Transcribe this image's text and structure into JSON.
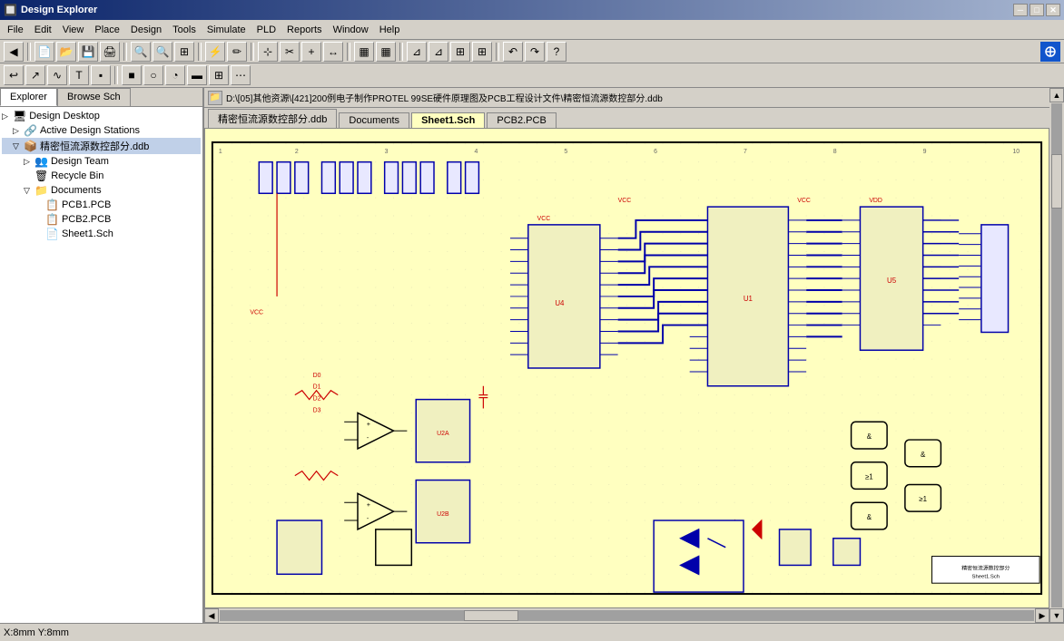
{
  "titlebar": {
    "title": "Design Explorer",
    "minimize": "─",
    "maximize": "□",
    "close": "✕"
  },
  "menu": {
    "items": [
      "File",
      "Edit",
      "View",
      "Place",
      "Design",
      "Tools",
      "Simulate",
      "PLD",
      "Reports",
      "Window",
      "Help"
    ]
  },
  "tabs": {
    "explorer": "Explorer",
    "browse_sch": "Browse Sch"
  },
  "tree": {
    "design_desktop": "Design Desktop",
    "active_design_stations": "Active Design Stations",
    "project_file": "精密恒流源数控部分.ddb",
    "design_team": "Design Team",
    "recycle_bin": "Recycle Bin",
    "documents": "Documents",
    "pcb1": "PCB1.PCB",
    "pcb2": "PCB2.PCB",
    "sheet1": "Sheet1.Sch"
  },
  "path_bar": {
    "path": "D:\\[05]其他资源\\[421]200例电子制作PROTEL 99SE硬件原理图及PCB工程设计文件\\精密恒流源数控部分.ddb"
  },
  "doc_tabs": {
    "ddb": "精密恒流源数控部分.ddb",
    "documents": "Documents",
    "sheet1": "Sheet1.Sch",
    "pcb2": "PCB2.PCB"
  },
  "status": {
    "coords": "X:8mm Y:8mm"
  }
}
